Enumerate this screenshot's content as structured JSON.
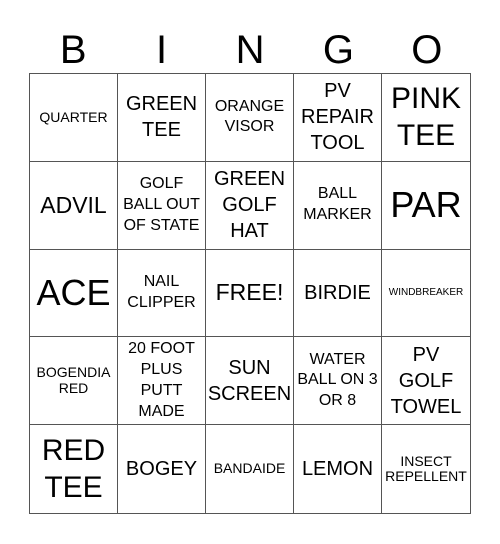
{
  "header": {
    "letters": [
      "B",
      "I",
      "N",
      "G",
      "O"
    ]
  },
  "card": {
    "cells": [
      {
        "text": "QUARTER",
        "size": "s-s"
      },
      {
        "text": "GREEN TEE",
        "size": "s-l"
      },
      {
        "text": "ORANGE VISOR",
        "size": "s-m"
      },
      {
        "text": "PV REPAIR TOOL",
        "size": "s-l"
      },
      {
        "text": "PINK TEE",
        "size": "s-xxl"
      },
      {
        "text": "ADVIL",
        "size": "s-xl"
      },
      {
        "text": "GOLF BALL OUT OF STATE",
        "size": "s-m"
      },
      {
        "text": "GREEN GOLF HAT",
        "size": "s-l"
      },
      {
        "text": "BALL MARKER",
        "size": "s-m"
      },
      {
        "text": "PAR",
        "size": "s-xxxl"
      },
      {
        "text": "ACE",
        "size": "s-xxxl"
      },
      {
        "text": "NAIL CLIPPER",
        "size": "s-m"
      },
      {
        "text": "FREE!",
        "size": "s-xl"
      },
      {
        "text": "BIRDIE",
        "size": "s-l"
      },
      {
        "text": "WINDBREAKER",
        "size": "s-xs"
      },
      {
        "text": "BOGENDIA RED",
        "size": "s-s"
      },
      {
        "text": "20 FOOT PLUS PUTT MADE",
        "size": "s-m"
      },
      {
        "text": "SUN SCREEN",
        "size": "s-l"
      },
      {
        "text": "WATER BALL ON 3 OR 8",
        "size": "s-m"
      },
      {
        "text": "PV GOLF TOWEL",
        "size": "s-l"
      },
      {
        "text": "RED TEE",
        "size": "s-xxl"
      },
      {
        "text": "BOGEY",
        "size": "s-l"
      },
      {
        "text": "BANDAIDE",
        "size": "s-s"
      },
      {
        "text": "LEMON",
        "size": "s-l"
      },
      {
        "text": "INSECT REPELLENT",
        "size": "s-s"
      }
    ]
  }
}
